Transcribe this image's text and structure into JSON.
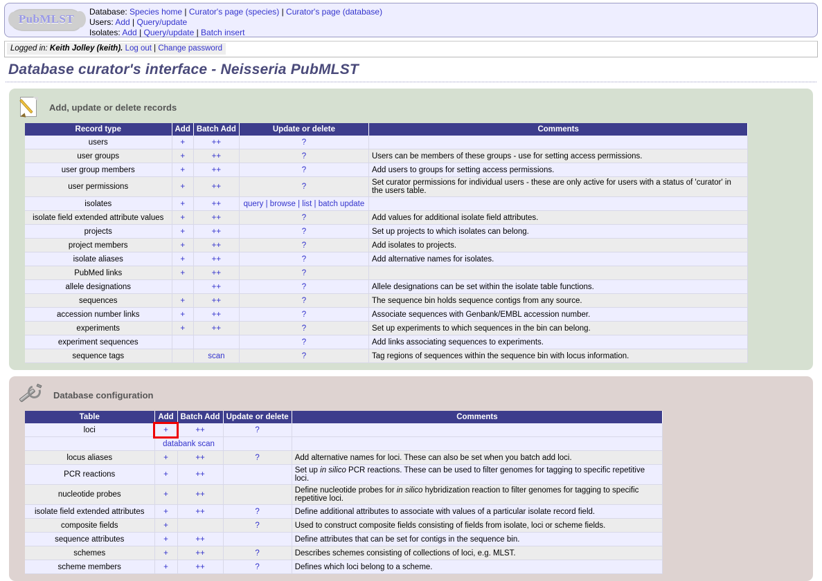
{
  "header": {
    "logo_text": "PubMLST",
    "rows": [
      {
        "label": "Database:",
        "links": [
          "Species home",
          "Curator's page (species)",
          "Curator's page (database)"
        ]
      },
      {
        "label": "Users:",
        "links": [
          "Add",
          "Query/update"
        ]
      },
      {
        "label": "Isolates:",
        "links": [
          "Add",
          "Query/update",
          "Batch insert"
        ]
      }
    ]
  },
  "login": {
    "prefix": "Logged in:",
    "user": "Keith Jolley (keith).",
    "logout": "Log out",
    "separator": "|",
    "change_password": "Change password"
  },
  "page_title": "Database curator's interface - Neisseria PubMLST",
  "records_panel": {
    "icon": "pencil-page-icon",
    "title": "Add, update or delete records",
    "columns": [
      "Record type",
      "Add",
      "Batch Add",
      "Update or delete",
      "Comments"
    ],
    "rows": [
      {
        "name": "users",
        "add": "+",
        "batch": "++",
        "update": "?",
        "comment": ""
      },
      {
        "name": "user groups",
        "add": "+",
        "batch": "++",
        "update": "?",
        "comment": "Users can be members of these groups - use for setting access permissions."
      },
      {
        "name": "user group members",
        "add": "+",
        "batch": "++",
        "update": "?",
        "comment": "Add users to groups for setting access permissions."
      },
      {
        "name": "user permissions",
        "add": "+",
        "batch": "++",
        "update": "?",
        "comment": "Set curator permissions for individual users - these are only active for users with a status of 'curator' in the users table."
      },
      {
        "name": "isolates",
        "add": "+",
        "batch": "++",
        "update_links": [
          "query",
          "browse",
          "list",
          "batch update"
        ],
        "comment": ""
      },
      {
        "name": "isolate field extended attribute values",
        "add": "+",
        "batch": "++",
        "update": "?",
        "comment": "Add values for additional isolate field attributes."
      },
      {
        "name": "projects",
        "add": "+",
        "batch": "++",
        "update": "?",
        "comment": "Set up projects to which isolates can belong."
      },
      {
        "name": "project members",
        "add": "+",
        "batch": "++",
        "update": "?",
        "comment": "Add isolates to projects."
      },
      {
        "name": "isolate aliases",
        "add": "+",
        "batch": "++",
        "update": "?",
        "comment": "Add alternative names for isolates."
      },
      {
        "name": "PubMed links",
        "add": "+",
        "batch": "++",
        "update": "?",
        "comment": ""
      },
      {
        "name": "allele designations",
        "add": "",
        "batch": "++",
        "update": "?",
        "comment": "Allele designations can be set within the isolate table functions."
      },
      {
        "name": "sequences",
        "add": "+",
        "batch": "++",
        "update": "?",
        "comment": "The sequence bin holds sequence contigs from any source."
      },
      {
        "name": "accession number links",
        "add": "+",
        "batch": "++",
        "update": "?",
        "comment": "Associate sequences with Genbank/EMBL accession number."
      },
      {
        "name": "experiments",
        "add": "+",
        "batch": "++",
        "update": "?",
        "comment": "Set up experiments to which sequences in the bin can belong."
      },
      {
        "name": "experiment sequences",
        "add": "",
        "batch": "",
        "update": "?",
        "comment": "Add links associating sequences to experiments."
      },
      {
        "name": "sequence tags",
        "add": "",
        "batch": "scan",
        "update": "?",
        "comment": "Tag regions of sequences within the sequence bin with locus information."
      }
    ]
  },
  "config_panel": {
    "icon": "wrench-icon",
    "title": "Database configuration",
    "columns": [
      "Table",
      "Add",
      "Batch Add",
      "Update or delete",
      "Comments"
    ],
    "loci_row": {
      "name": "loci",
      "add": "+",
      "batch": "++",
      "update": "?",
      "comment": "",
      "extra_link": "databank scan",
      "highlighted": true
    },
    "rows": [
      {
        "name": "locus aliases",
        "add": "+",
        "batch": "++",
        "update": "?",
        "comment": "Add alternative names for loci. These can also be set when you batch add loci."
      },
      {
        "name": "PCR reactions",
        "add": "+",
        "batch": "++",
        "update": "",
        "comment_parts": [
          "Set up ",
          "in silico",
          " PCR reactions. These can be used to filter genomes for tagging to specific repetitive loci."
        ]
      },
      {
        "name": "nucleotide probes",
        "add": "+",
        "batch": "++",
        "update": "",
        "comment_parts": [
          "Define nucleotide probes for ",
          "in silico",
          " hybridization reaction to filter genomes for tagging to specific repetitive loci."
        ]
      },
      {
        "name": "isolate field extended attributes",
        "add": "+",
        "batch": "++",
        "update": "?",
        "comment": "Define additional attributes to associate with values of a particular isolate record field."
      },
      {
        "name": "composite fields",
        "add": "+",
        "batch": "",
        "update": "?",
        "comment": "Used to construct composite fields consisting of fields from isolate, loci or scheme fields."
      },
      {
        "name": "sequence attributes",
        "add": "+",
        "batch": "++",
        "update": "",
        "comment": "Define attributes that can be set for contigs in the sequence bin."
      },
      {
        "name": "schemes",
        "add": "+",
        "batch": "++",
        "update": "?",
        "comment": "Describes schemes consisting of collections of loci, e.g. MLST."
      },
      {
        "name": "scheme members",
        "add": "+",
        "batch": "++",
        "update": "?",
        "comment": "Defines which loci belong to a scheme."
      }
    ]
  },
  "colors": {
    "table_header": "#3d3d8c",
    "link": "#3333cc",
    "panel_green": "#d6e0d1",
    "panel_pink": "#ded3d1",
    "highlight": "#ee0000",
    "title": "#4a4a7a"
  }
}
